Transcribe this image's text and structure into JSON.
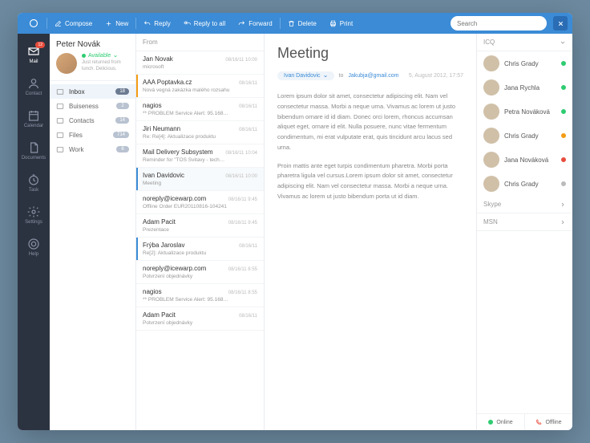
{
  "toolbar": {
    "compose": "Compose",
    "new": "New",
    "reply": "Reply",
    "reply_all": "Reply to all",
    "forward": "Forward",
    "delete": "Delete",
    "print": "Print",
    "search_placeholder": "Search"
  },
  "rail": [
    {
      "id": "mail",
      "label": "Mail",
      "badge": "12"
    },
    {
      "id": "contact",
      "label": "Contact"
    },
    {
      "id": "calendar",
      "label": "Calendar"
    },
    {
      "id": "documents",
      "label": "Documents"
    },
    {
      "id": "task",
      "label": "Task"
    },
    {
      "id": "settings",
      "label": "Settings"
    },
    {
      "id": "help",
      "label": "Help"
    }
  ],
  "user": {
    "name": "Peter Novák",
    "status": "Available",
    "note": "Just returned from lunch. Delicious."
  },
  "folders": [
    {
      "label": "Inbox",
      "count": "18",
      "sel": true
    },
    {
      "label": "Buiseness",
      "count": "2"
    },
    {
      "label": "Contacts",
      "count": "14"
    },
    {
      "label": "Files",
      "count": "714"
    },
    {
      "label": "Work",
      "count": "6"
    }
  ],
  "msg_header": "From",
  "messages": [
    {
      "from": "Jan Novak",
      "time": "08/16/11 10:00",
      "subj": "microsoft"
    },
    {
      "from": "AAA Poptavka.cz",
      "time": "08/16/11",
      "subj": "Nová vegná zakázka malého rozsahu",
      "accent": "o"
    },
    {
      "from": "nagios",
      "time": "08/16/11",
      "subj": "** PROBLEM Service Alert: 95.168…"
    },
    {
      "from": "Jiri Neumann",
      "time": "08/16/11",
      "subj": "Re: Re[4]: Aktualizace produktu"
    },
    {
      "from": "Mail Delivery Subsystem",
      "time": "08/16/11 10:04",
      "subj": "Reminder for \"TOS Svitavy - tech…"
    },
    {
      "from": "Ivan Davidovic",
      "time": "08/16/11 10:00",
      "subj": "Meeting",
      "sel": true
    },
    {
      "from": "noreply@icewarp.com",
      "time": "08/16/11 9:45",
      "subj": "Offline Order EUR20110816-104241"
    },
    {
      "from": "Adam Pacit",
      "time": "08/16/11 9:45",
      "subj": "Prezentace"
    },
    {
      "from": "Frýba Jaroslav",
      "time": "08/16/11",
      "subj": "Re[2]: Aktualizace produktu",
      "accent": "b"
    },
    {
      "from": "noreply@icewarp.com",
      "time": "08/16/11 8:55",
      "subj": "Potvrzení objednávky"
    },
    {
      "from": "nagios",
      "time": "08/16/11 8:55",
      "subj": "** PROBLEM Service Alert: 95.168…"
    },
    {
      "from": "Adam Pacit",
      "time": "08/16/11",
      "subj": "Potvrzení objednávky"
    }
  ],
  "reader": {
    "title": "Meeting",
    "from": "Ivan Davidovic",
    "to_label": "to",
    "to_email": "Jakubja@gmail.com",
    "date": "5, August 2012, 17:57",
    "p1": "Lorem ipsum dolor sit amet, consectetur adipiscing elit. Nam vel consectetur massa. Morbi a neque urna. Vivamus ac lorem ut justo bibendum ornare id id diam. Donec orci lorem, rhoncus accumsan aliquet eget, ornare id elit. Nulla posuere, nunc vitae fermentum condimentum, mi erat vulputate erat, quis tincidunt arcu lacus sed urna.",
    "p2": "Proin mattis ante eget turpis condimentum pharetra. Morbi porta pharetra ligula vel cursus.Lorem ipsum dolor sit amet, consectetur adipiscing elit. Nam vel consectetur massa. Morbi a neque urna. Vivamus ac lorem ut justo bibendum porta ut id diam."
  },
  "contacts": {
    "groups": [
      {
        "label": "ICQ",
        "open": true
      },
      {
        "label": "Skype"
      },
      {
        "label": "MSN"
      }
    ],
    "items": [
      {
        "name": "Chris Grady",
        "dot": "g"
      },
      {
        "name": "Jana Rychla",
        "dot": "g"
      },
      {
        "name": "Petra Nováková",
        "dot": "g"
      },
      {
        "name": "Chris Grady",
        "dot": "o"
      },
      {
        "name": "Jana Nováková",
        "dot": "r"
      },
      {
        "name": "Chris Grady",
        "dot": "gr"
      }
    ],
    "footer": {
      "online": "Online",
      "offline": "Offline"
    }
  }
}
